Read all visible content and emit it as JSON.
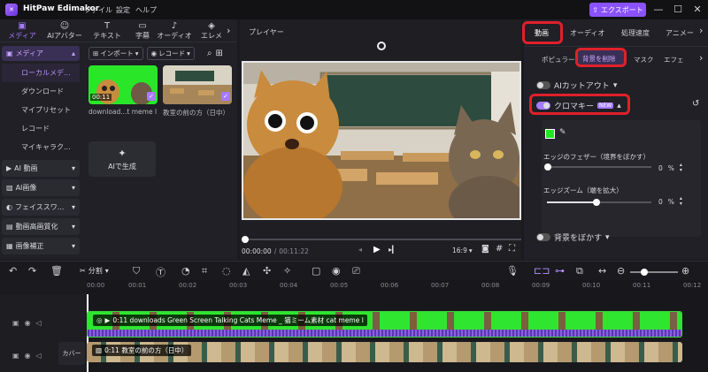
{
  "titlebar": {
    "app_title": "HitPaw Edimakor",
    "menus": [
      "ファイル",
      "設定",
      "ヘルプ"
    ],
    "export_label": "エクスポート",
    "colors": {
      "accent": "#8a52ff"
    }
  },
  "left_tabs": [
    {
      "label": "メディア",
      "icon": "media-icon",
      "active": true
    },
    {
      "label": "AIアバター",
      "icon": "avatar-icon"
    },
    {
      "label": "テキスト",
      "icon": "text-icon"
    },
    {
      "label": "字幕",
      "icon": "subtitle-icon"
    },
    {
      "label": "オーディオ",
      "icon": "audio-icon"
    },
    {
      "label": "エレメ",
      "icon": "element-icon"
    }
  ],
  "sidebar": {
    "media_group": "メディア",
    "media_items": [
      "ローカルメデ...",
      "ダウンロード",
      "マイプリセット",
      "レコード",
      "マイキャラク..."
    ],
    "groups": [
      "AI 動画",
      "AI画像",
      "フェイススワ...",
      "動画高画質化",
      "画像補正"
    ]
  },
  "media_toolbar": {
    "import_label": "インポート",
    "record_label": "レコード"
  },
  "media_items": [
    {
      "caption": "download...t meme l",
      "duration": "00:11"
    },
    {
      "caption": "教室の前の方（日中）",
      "duration": ""
    }
  ],
  "ai_generate_label": "AIで生成",
  "player": {
    "title": "プレイヤー",
    "time_current": "00:00:00",
    "time_total": "00:11:22",
    "aspect": "16:9"
  },
  "right_panel": {
    "tabs": [
      "動画",
      "オーディオ",
      "処理速度",
      "アニメー"
    ],
    "subtabs": [
      "ポピュラー",
      "背景を削除",
      "マスク",
      "エフェ"
    ],
    "ai_cutout_label": "AIカットアウト",
    "chroma_label": "クロマキー",
    "new_badge": "NEW",
    "chroma_color": "#22e622",
    "feather_label": "エッジのフェザー（境界をぼかす）",
    "feather_value": "0",
    "feather_unit": "%",
    "zoom_label": "エッジズーム（端を拡大）",
    "zoom_value": "0",
    "zoom_unit": "%",
    "blur_bg_label": "背景をぼかす"
  },
  "timeline": {
    "split_label": "分割",
    "ticks": [
      "00:00",
      "00:01",
      "00:02",
      "00:03",
      "00:04",
      "00:05",
      "00:06",
      "00:07",
      "00:08",
      "00:09",
      "00:10",
      "00:11",
      "00:12"
    ],
    "clip1_label": "0:11 downloads Green Screen Talking Cats Meme _ 猫ミーム素材 cat meme l",
    "clip2_label": "0:11 教室の前の方（日中）",
    "cover_label": "カバー"
  }
}
